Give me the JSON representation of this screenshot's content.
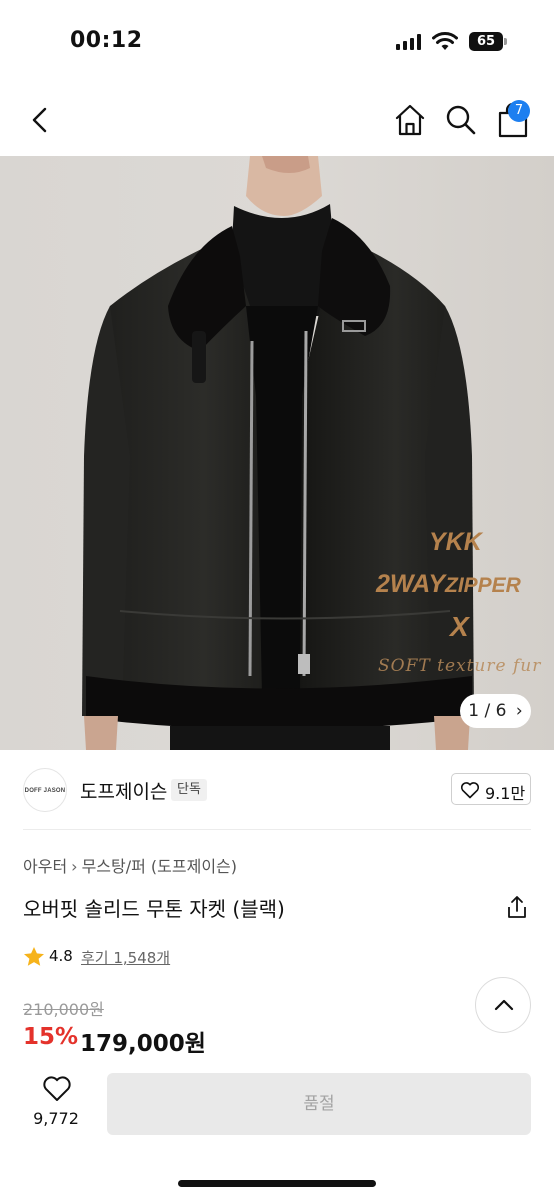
{
  "status_bar": {
    "time": "00:12",
    "battery": "65",
    "icons": [
      "signal-icon",
      "wifi-icon",
      "battery-icon"
    ]
  },
  "nav": {
    "icons": [
      "back-arrow-icon",
      "home-icon",
      "search-icon",
      "shopping-bag-icon"
    ],
    "cart_count": "7"
  },
  "gallery": {
    "overlay_line1": "YKK",
    "overlay_line2_main": "2WAY",
    "overlay_line2_small": "ZIPPER",
    "overlay_line3": "X",
    "overlay_line4": "SOFT texture fur",
    "pager_text": "1 / 6",
    "pager_icon": "chevron-right-icon"
  },
  "brand": {
    "logo_text": "DOFF JASON",
    "name": "도프제이슨",
    "tag": "단독",
    "like_count": "9.1만"
  },
  "product": {
    "breadcrumb": [
      "아우터",
      "무스탕/퍼 (도프제이슨)"
    ],
    "title": "오버핏 솔리드 무톤 자켓 (블랙)",
    "rating": "4.8",
    "reviews_label": "후기 1,548개",
    "original_price": "210,000원",
    "discount_rate": "15%",
    "sale_price": "179,000원"
  },
  "bottom_bar": {
    "wish_count": "9,772",
    "soldout_label": "품절"
  },
  "colors": {
    "accent_badge": "#1d7ff0",
    "discount": "#e4322b",
    "star": "#f6b31b",
    "overlay_text": "#b5824d"
  }
}
